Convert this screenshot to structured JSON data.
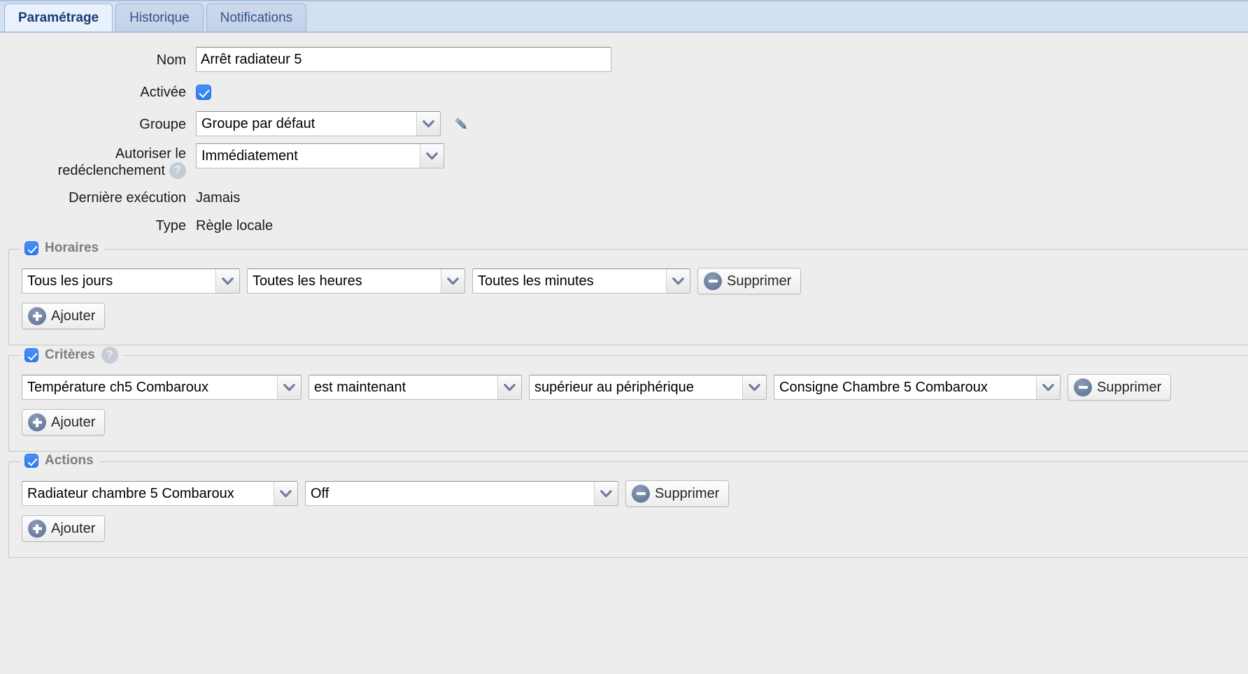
{
  "tabs": [
    {
      "label": "Paramétrage",
      "active": true
    },
    {
      "label": "Historique",
      "active": false
    },
    {
      "label": "Notifications",
      "active": false
    }
  ],
  "form": {
    "nom": {
      "label": "Nom",
      "value": "Arrêt radiateur 5"
    },
    "activee": {
      "label": "Activée",
      "checked": true
    },
    "groupe": {
      "label": "Groupe",
      "value": "Groupe par défaut",
      "edit_icon": "pencil-icon"
    },
    "redeclenchement": {
      "label_line1": "Autoriser le",
      "label_line2": "redéclenchement",
      "help": "?",
      "value": "Immédiatement"
    },
    "derniere_execution": {
      "label": "Dernière exécution",
      "value": "Jamais"
    },
    "type": {
      "label": "Type",
      "value": "Règle locale"
    }
  },
  "sections": {
    "horaires": {
      "legend": "Horaires",
      "checked": true,
      "rows": [
        {
          "jours": "Tous les jours",
          "heures": "Toutes les heures",
          "minutes": "Toutes les minutes",
          "delete_label": "Supprimer"
        }
      ],
      "add_label": "Ajouter"
    },
    "criteres": {
      "legend": "Critères",
      "checked": true,
      "help": "?",
      "rows": [
        {
          "source": "Température ch5 Combaroux",
          "etat": "est maintenant",
          "comparateur": "supérieur au périphérique",
          "cible": "Consigne Chambre 5 Combaroux",
          "delete_label": "Supprimer"
        }
      ],
      "add_label": "Ajouter"
    },
    "actions": {
      "legend": "Actions",
      "checked": true,
      "rows": [
        {
          "peripherique": "Radiateur chambre 5 Combaroux",
          "commande": "Off",
          "delete_label": "Supprimer"
        }
      ],
      "add_label": "Ajouter"
    }
  },
  "colors": {
    "accent_blue": "#2b7cf0",
    "tab_bar": "#d3e0f2",
    "active_tab_text": "#1b3c78",
    "page_bg": "#ededed",
    "legend_text": "#7e7e7e",
    "icon_slate": "#6d7f9f"
  }
}
